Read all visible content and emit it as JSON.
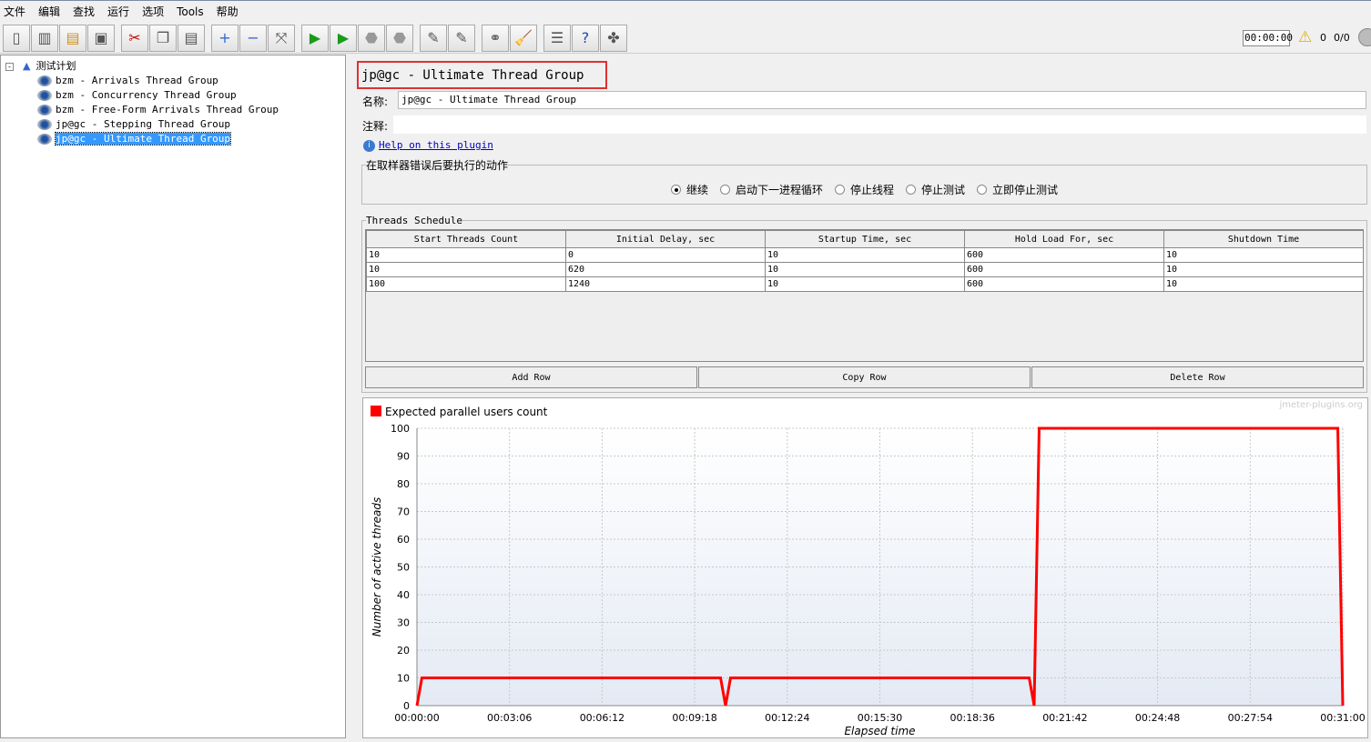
{
  "menu": [
    "文件",
    "编辑",
    "查找",
    "运行",
    "选项",
    "Tools",
    "帮助"
  ],
  "toolbar": {
    "icons": [
      "new-icon",
      "templates-icon",
      "open-icon",
      "save-icon",
      "cut-icon",
      "copy-icon",
      "paste-icon",
      "expand-icon",
      "collapse-icon",
      "toggle-icon",
      "start-icon",
      "start-no-pause-icon",
      "stop-icon",
      "shutdown-icon",
      "clear-icon",
      "clear-all-icon",
      "search-icon",
      "reset-search-icon",
      "function-helper-icon",
      "help-icon",
      "remote-icon"
    ],
    "timer": "00:00:00",
    "warnings": "0",
    "threads": "0/0"
  },
  "tree": {
    "root": "测试计划",
    "items": [
      "bzm - Arrivals Thread Group",
      "bzm - Concurrency Thread Group",
      "bzm - Free-Form Arrivals Thread Group",
      "jp@gc - Stepping Thread Group",
      "jp@gc - Ultimate Thread Group"
    ],
    "selected": 4
  },
  "panel": {
    "title": "jp@gc - Ultimate Thread Group",
    "name_label": "名称:",
    "name_value": "jp@gc - Ultimate Thread Group",
    "comment_label": "注释:",
    "comment_value": "",
    "help_link": "Help on this plugin"
  },
  "error_action": {
    "legend": "在取样器错误后要执行的动作",
    "options": [
      "继续",
      "启动下一进程循环",
      "停止线程",
      "停止测试",
      "立即停止测试"
    ],
    "selected": 0
  },
  "schedule": {
    "legend": "Threads Schedule",
    "columns": [
      "Start Threads Count",
      "Initial Delay, sec",
      "Startup Time, sec",
      "Hold Load For, sec",
      "Shutdown Time"
    ],
    "rows": [
      [
        "10",
        "0",
        "10",
        "600",
        "10"
      ],
      [
        "10",
        "620",
        "10",
        "600",
        "10"
      ],
      [
        "100",
        "1240",
        "10",
        "600",
        "10"
      ]
    ],
    "buttons": [
      "Add Row",
      "Copy Row",
      "Delete Row"
    ]
  },
  "chart_data": {
    "type": "line",
    "watermark": "jmeter-plugins.org",
    "legend": "Expected parallel users count",
    "legend_placement": "top-left",
    "series_color": "#ff0000",
    "xlabel": "Elapsed time",
    "ylabel": "Number of active threads",
    "xlim": [
      0,
      1860
    ],
    "ylim": [
      0,
      100
    ],
    "grid": true,
    "x_ticks": [
      "00:00:00",
      "00:03:06",
      "00:06:12",
      "00:09:18",
      "00:12:24",
      "00:15:30",
      "00:18:36",
      "00:21:42",
      "00:24:48",
      "00:27:54",
      "00:31:00"
    ],
    "y_ticks": [
      0,
      10,
      20,
      30,
      40,
      50,
      60,
      70,
      80,
      90,
      100
    ],
    "points": [
      [
        0,
        0
      ],
      [
        10,
        10
      ],
      [
        610,
        10
      ],
      [
        620,
        0
      ],
      [
        630,
        10
      ],
      [
        1230,
        10
      ],
      [
        1240,
        0
      ],
      [
        1250,
        100
      ],
      [
        1850,
        100
      ],
      [
        1860,
        0
      ]
    ]
  }
}
